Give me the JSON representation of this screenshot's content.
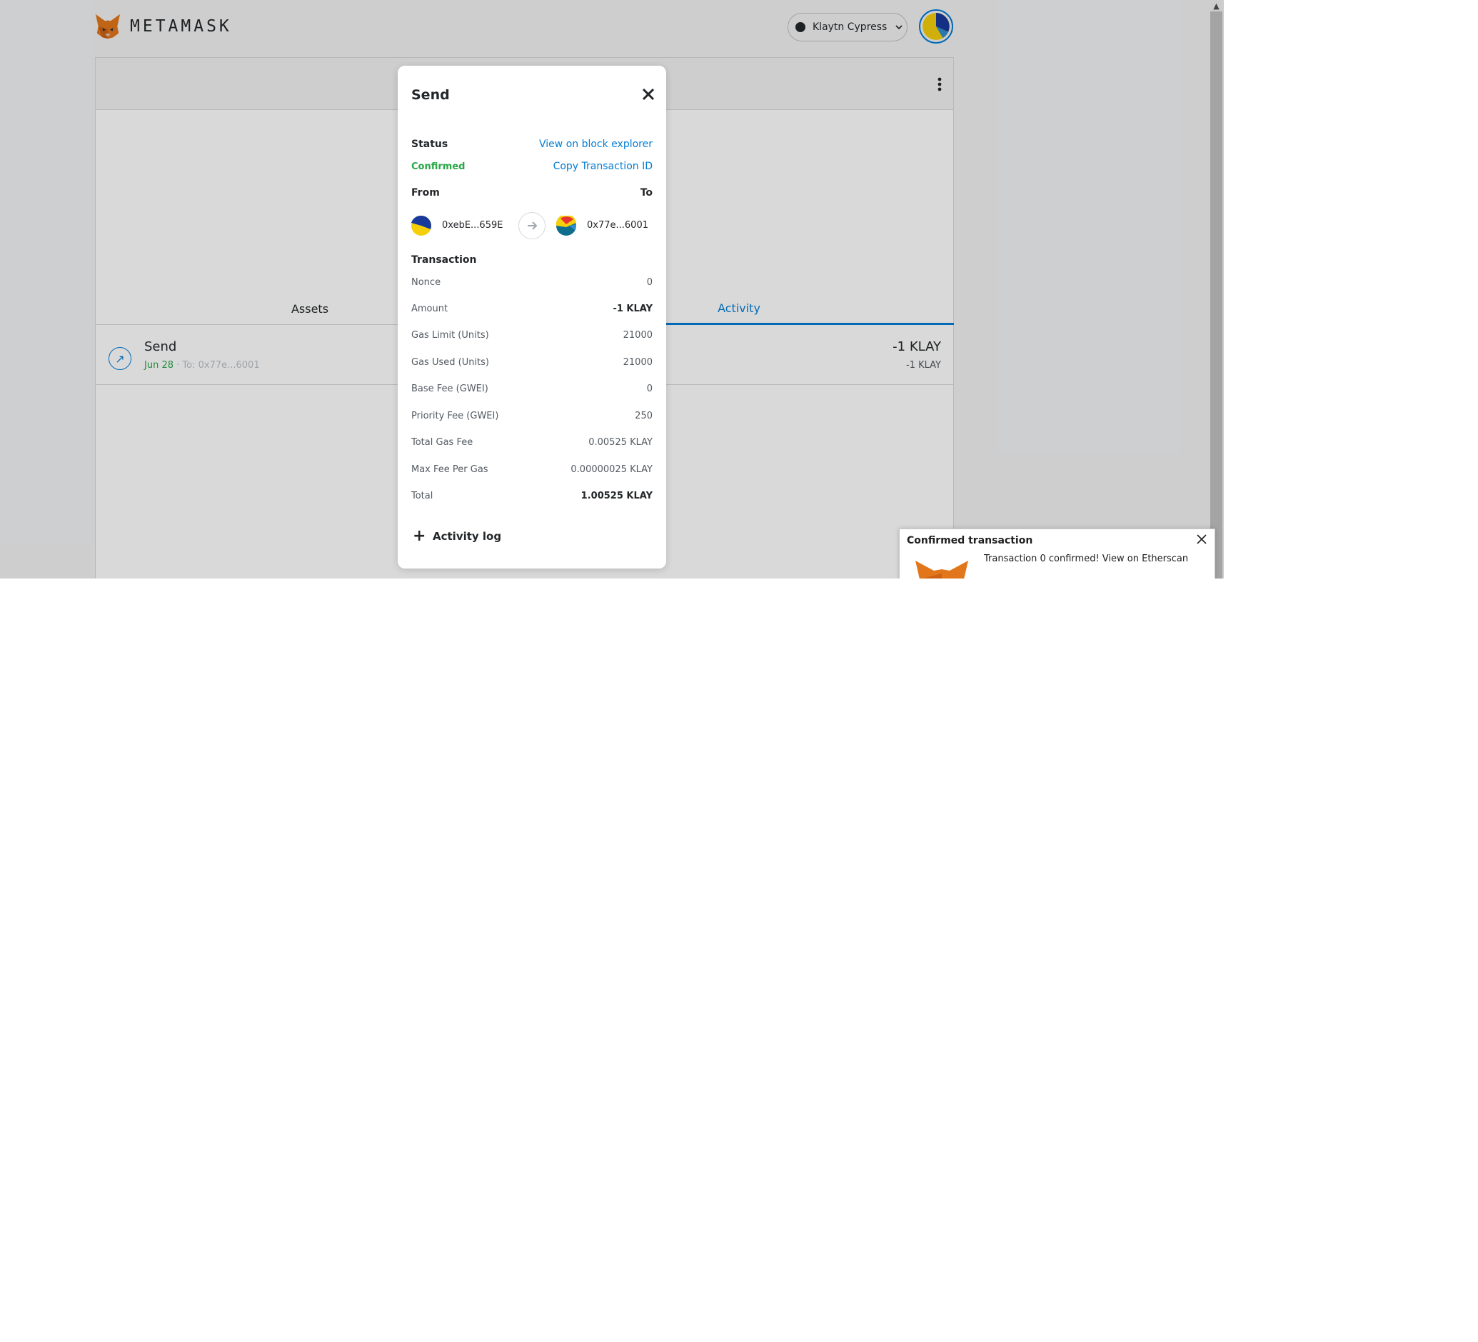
{
  "header": {
    "brand": "METAMASK",
    "network": "Klaytn Cypress"
  },
  "tabs": {
    "assets": "Assets",
    "activity": "Activity"
  },
  "activity_item": {
    "title": "Send",
    "date": "Jun 28",
    "separator": " · ",
    "to": "To: 0x77e...6001",
    "amount": "-1 KLAY",
    "amount_secondary": "-1 KLAY"
  },
  "modal": {
    "title": "Send",
    "status_label": "Status",
    "status_value": "Confirmed",
    "view_explorer": "View on block explorer",
    "copy_tx_id": "Copy Transaction ID",
    "from_label": "From",
    "to_label": "To",
    "from_address": "0xebE...659E",
    "to_address": "0x77e...6001",
    "transaction_label": "Transaction",
    "details": [
      {
        "label": "Nonce",
        "value": "0"
      },
      {
        "label": "Amount",
        "value": "-1 KLAY"
      },
      {
        "label": "Gas Limit (Units)",
        "value": "21000"
      },
      {
        "label": "Gas Used (Units)",
        "value": "21000"
      },
      {
        "label": "Base Fee (GWEI)",
        "value": "0"
      },
      {
        "label": "Priority Fee (GWEI)",
        "value": "250"
      },
      {
        "label": "Total Gas Fee",
        "value": "0.00525 KLAY"
      },
      {
        "label": "Max Fee Per Gas",
        "value": "0.00000025 KLAY"
      },
      {
        "label": "Total",
        "value": "1.00525 KLAY"
      }
    ],
    "activity_log": "Activity log"
  },
  "toast": {
    "title": "Confirmed transaction",
    "message": "Transaction 0 confirmed! View on Etherscan"
  },
  "colors": {
    "accent": "#037dd6",
    "success": "#28a745",
    "text": "#24272a",
    "muted": "#535a61"
  }
}
